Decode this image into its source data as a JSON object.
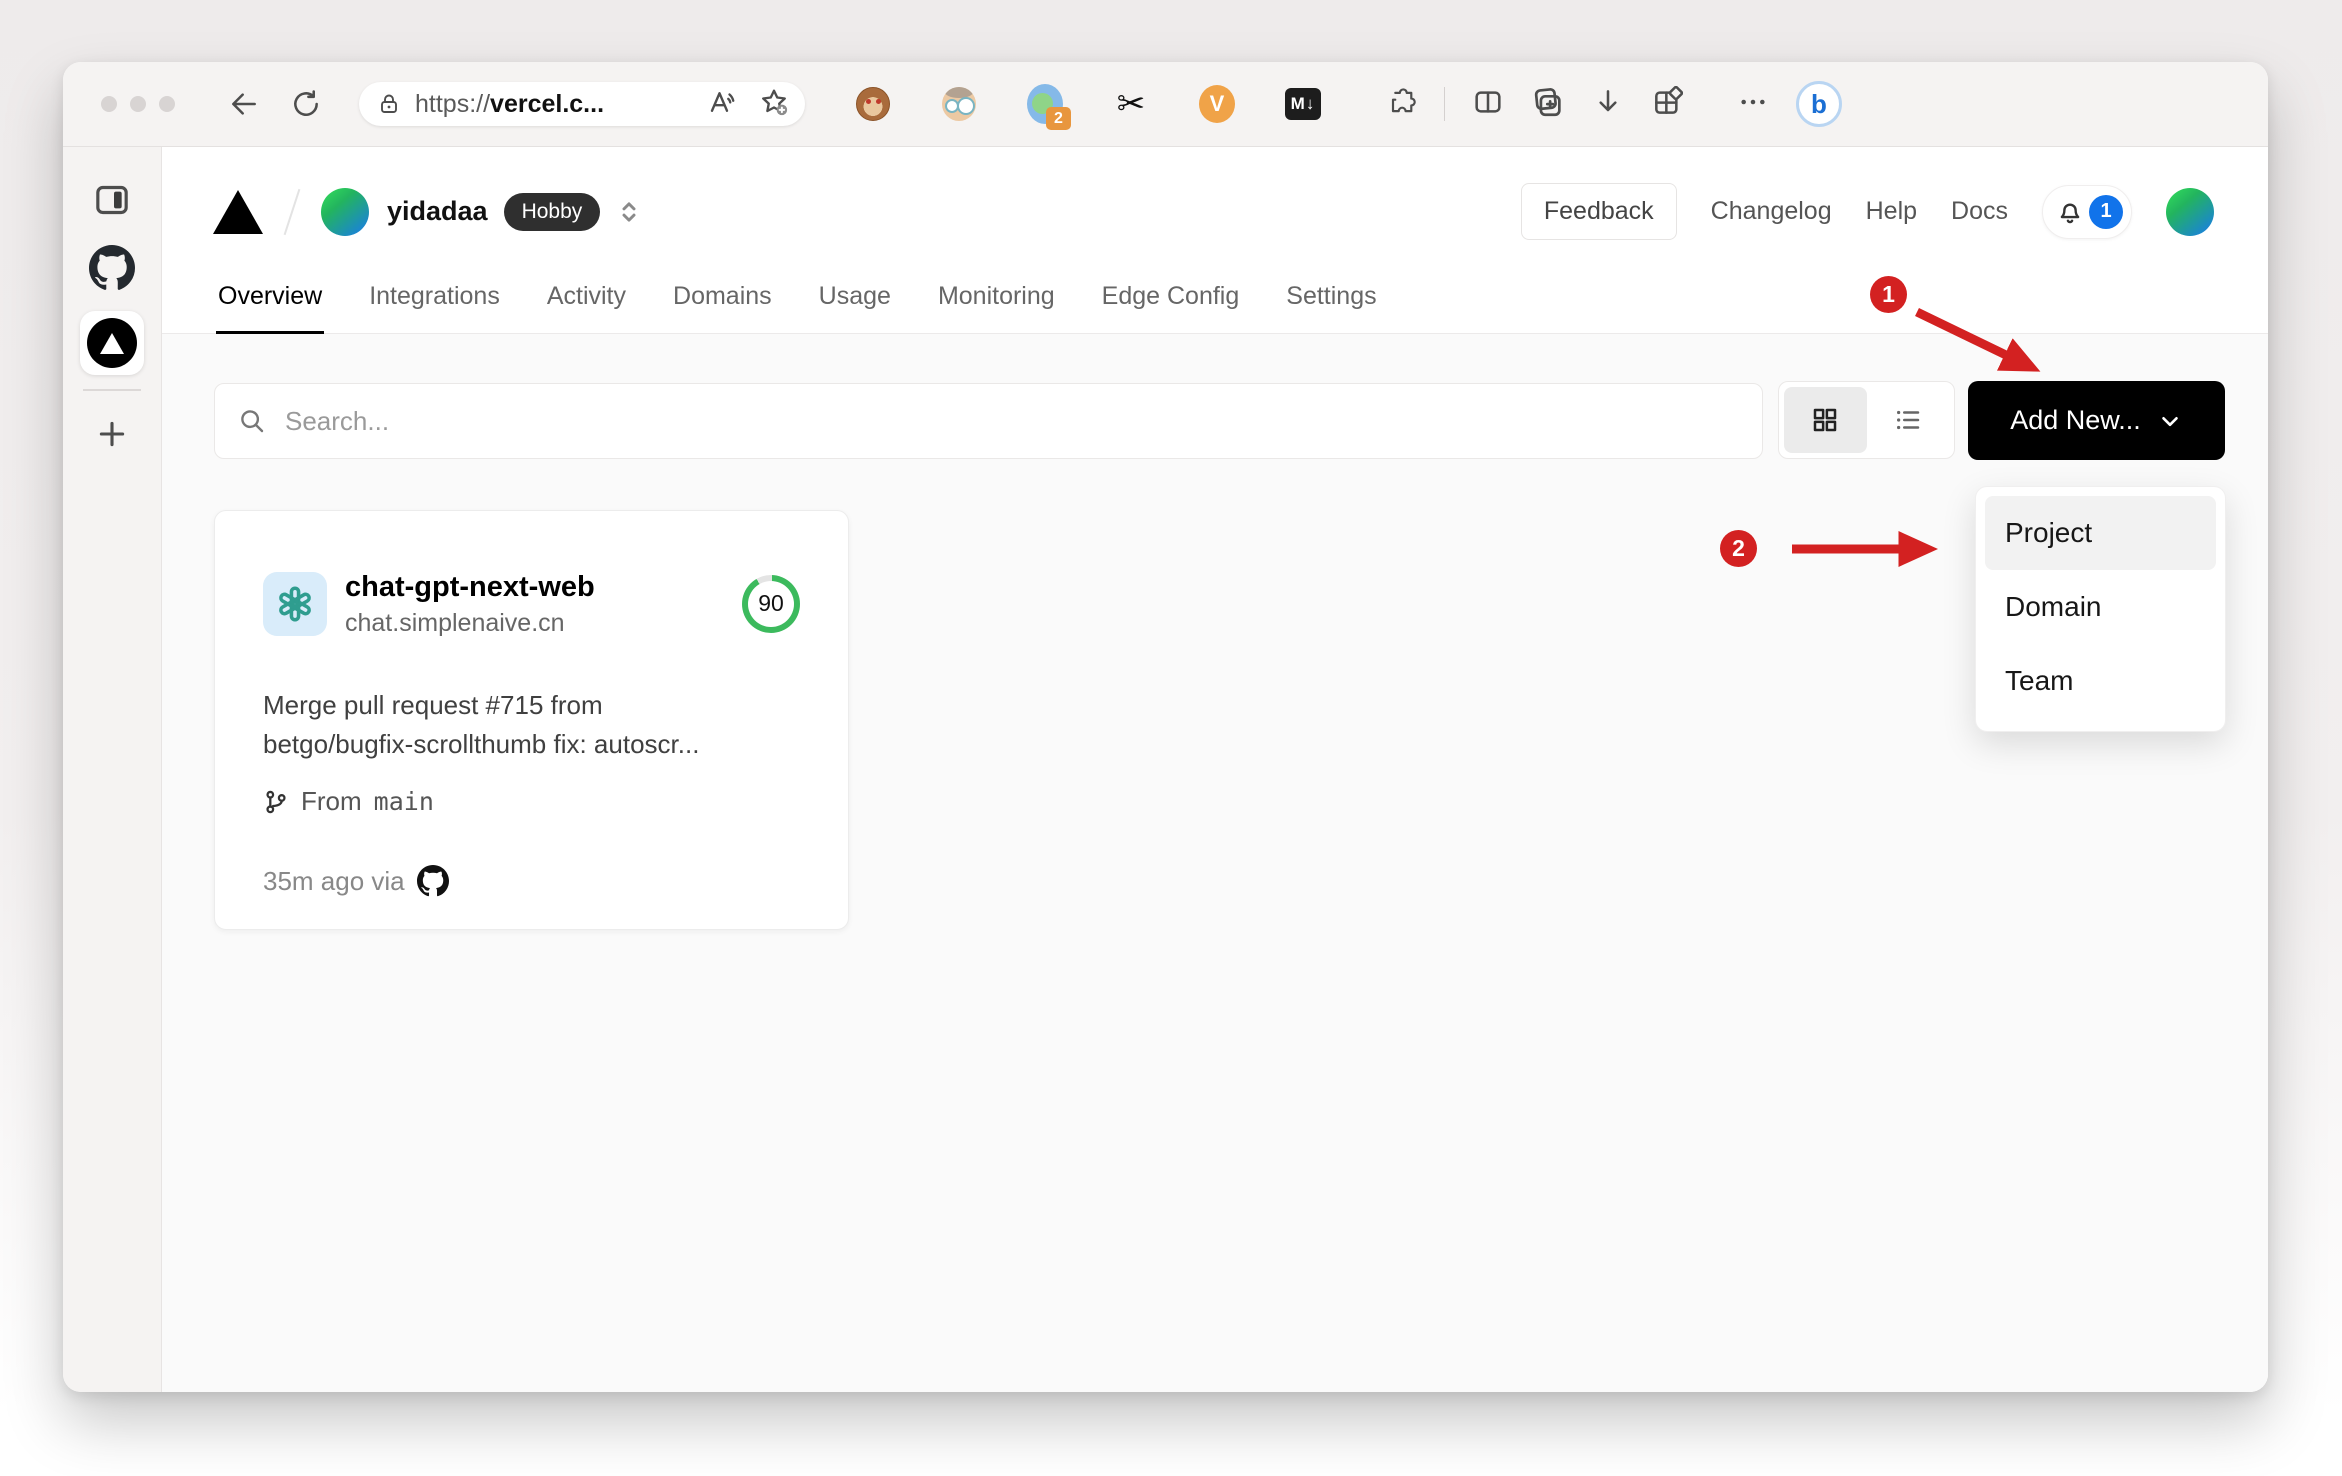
{
  "browser": {
    "url": {
      "prefix": "https://",
      "host": "vercel.c..."
    },
    "extensions": {
      "proxy_badge": "2",
      "scissors_glyph": "✂",
      "video_label": "V",
      "markdown_label": "M↓"
    },
    "bing_label": "b"
  },
  "vercel": {
    "team": {
      "name": "yidadaa",
      "plan": "Hobby"
    },
    "header": {
      "feedback": "Feedback",
      "changelog": "Changelog",
      "help": "Help",
      "docs": "Docs",
      "notifications": "1"
    },
    "tabs": [
      {
        "label": "Overview"
      },
      {
        "label": "Integrations"
      },
      {
        "label": "Activity"
      },
      {
        "label": "Domains"
      },
      {
        "label": "Usage"
      },
      {
        "label": "Monitoring"
      },
      {
        "label": "Edge Config"
      },
      {
        "label": "Settings"
      }
    ],
    "controls": {
      "search_placeholder": "Search...",
      "add_new": "Add New..."
    },
    "dropdown": {
      "items": [
        {
          "label": "Project"
        },
        {
          "label": "Domain"
        },
        {
          "label": "Team"
        }
      ]
    },
    "project": {
      "name": "chat-gpt-next-web",
      "domain": "chat.simplenaive.cn",
      "score": "90",
      "commit_line1": "Merge pull request #715 from",
      "commit_line2": "betgo/bugfix-scrollthumb fix: autoscr...",
      "branch_label": "From",
      "branch": "main",
      "meta": "35m ago via"
    }
  },
  "annotations": {
    "step1": "1",
    "step2": "2"
  },
  "colors": {
    "annotation_red": "#d32121",
    "score_green": "#3cba5d",
    "notification_blue": "#1173ea",
    "button_black": "#000000"
  }
}
